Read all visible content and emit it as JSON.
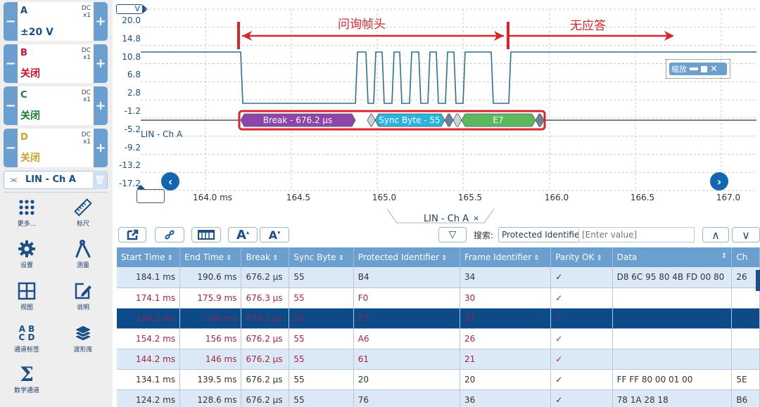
{
  "channels": [
    {
      "name": "A",
      "coupling": "DC",
      "probe": "x1",
      "range": "±20 V",
      "color": "#1b4f86"
    },
    {
      "name": "B",
      "coupling": "DC",
      "probe": "x1",
      "range": "关闭",
      "color": "#c8102e"
    },
    {
      "name": "C",
      "coupling": "DC",
      "probe": "x1",
      "range": "关闭",
      "color": "#1a7a3a"
    },
    {
      "name": "D",
      "coupling": "DC",
      "probe": "x1",
      "range": "关闭",
      "color": "#c9a227"
    }
  ],
  "decoder": {
    "label": "LIN - Ch A"
  },
  "tools": [
    {
      "icon": "more-grid-icon",
      "label": "更多..."
    },
    {
      "icon": "ruler-icon",
      "label": "标尺"
    },
    {
      "icon": "gear-icon",
      "label": "设置"
    },
    {
      "icon": "compass-icon",
      "label": "测量"
    },
    {
      "icon": "view-grid-icon",
      "label": "视图"
    },
    {
      "icon": "note-edit-icon",
      "label": "说明"
    },
    {
      "icon": "abcd-icon",
      "label": "通道标签"
    },
    {
      "icon": "waveform-library-icon",
      "label": "波形库"
    },
    {
      "icon": "sigma-icon",
      "label": "数学通道"
    }
  ],
  "scope": {
    "unit": "V",
    "y_ticks": [
      "20.0",
      "14.8",
      "10.8",
      "6.8",
      "2.8",
      "-1.2",
      "-5.2",
      "-9.2",
      "-13.2",
      "-17.2"
    ],
    "x_ticks": [
      "164.0 ms",
      "164.5",
      "165.0",
      "165.5",
      "166.0",
      "166.5",
      "167.0"
    ],
    "trace_label": "LIN - Ch A",
    "annotations": {
      "header": "问询帧头",
      "no_response": "无应答"
    },
    "decode_segments": [
      {
        "label": "Break - 676.2 µs",
        "color": "#8e44a8"
      },
      {
        "label": "Sync Byte - 55",
        "color": "#2bb3e0"
      },
      {
        "label": "E7",
        "color": "#5cb85c"
      }
    ],
    "zoom_overlay": {
      "label": "缩放"
    }
  },
  "table": {
    "tab_label": "LIN - Ch A",
    "search_label": "搜索:",
    "search_field": "Protected Identifier",
    "search_placeholder": "[Enter value]",
    "columns": [
      "Start Time",
      "End Time",
      "Break",
      "Sync Byte",
      "Protected Identifier",
      "Frame Identifier",
      "Parity OK",
      "Data",
      "Ch"
    ],
    "rows": [
      {
        "start": "184.1 ms",
        "end": "190.6 ms",
        "brk": "676.2 µs",
        "sync": "55",
        "pid": "B4",
        "fid": "34",
        "parity": "✓",
        "data": "D8 6C 95 80 4B FD 00 80",
        "ch": "26",
        "style": "normal"
      },
      {
        "start": "174.1 ms",
        "end": "175.9 ms",
        "brk": "676.3 µs",
        "sync": "55",
        "pid": "F0",
        "fid": "30",
        "parity": "✓",
        "data": "",
        "ch": "",
        "style": "red"
      },
      {
        "start": "164.2 ms",
        "end": "166 ms",
        "brk": "676.2 µs",
        "sync": "55",
        "pid": "E7",
        "fid": "27",
        "parity": "✓",
        "data": "",
        "ch": "",
        "style": "selected"
      },
      {
        "start": "154.2 ms",
        "end": "156 ms",
        "brk": "676.2 µs",
        "sync": "55",
        "pid": "A6",
        "fid": "26",
        "parity": "✓",
        "data": "",
        "ch": "",
        "style": "red"
      },
      {
        "start": "144.2 ms",
        "end": "146 ms",
        "brk": "676.2 µs",
        "sync": "55",
        "pid": "61",
        "fid": "21",
        "parity": "✓",
        "data": "",
        "ch": "",
        "style": "red"
      },
      {
        "start": "134.1 ms",
        "end": "139.5 ms",
        "brk": "676.2 µs",
        "sync": "55",
        "pid": "20",
        "fid": "20",
        "parity": "✓",
        "data": "FF FF 80 00 01 00",
        "ch": "5E",
        "style": "normal"
      },
      {
        "start": "124.2 ms",
        "end": "128.6 ms",
        "brk": "676.2 µs",
        "sync": "55",
        "pid": "76",
        "fid": "36",
        "parity": "✓",
        "data": "78 1A 28 18",
        "ch": "B6",
        "style": "normal"
      }
    ]
  }
}
